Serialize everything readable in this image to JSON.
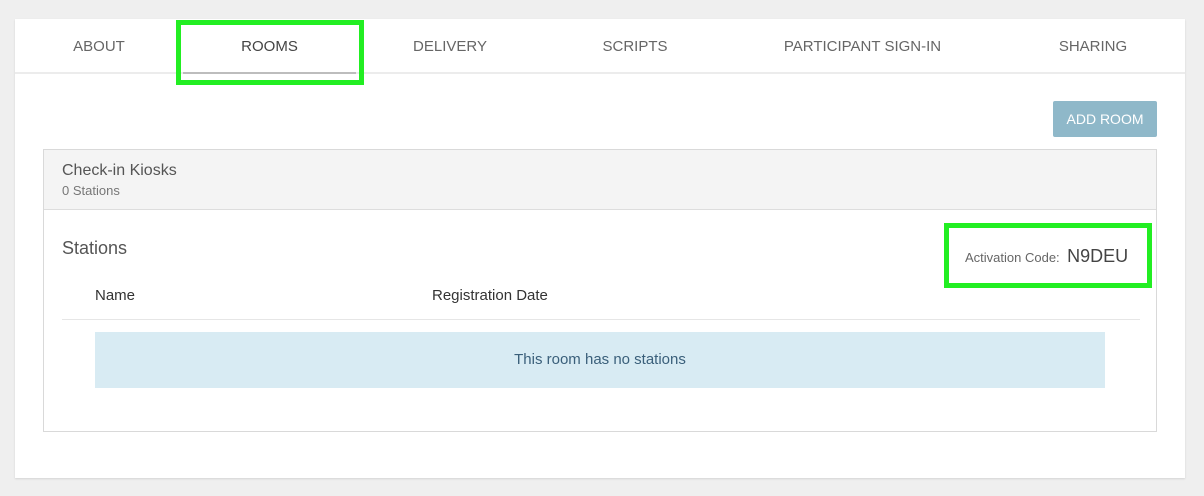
{
  "tabs": [
    {
      "label": "About"
    },
    {
      "label": "Rooms"
    },
    {
      "label": "Delivery"
    },
    {
      "label": "Scripts"
    },
    {
      "label": "Participant Sign-in"
    },
    {
      "label": "Sharing"
    }
  ],
  "active_tab": "Rooms",
  "actions": {
    "add_room_label": "Add Room"
  },
  "room": {
    "title": "Check-in Kiosks",
    "station_count": "0 Stations"
  },
  "stations": {
    "title": "Stations",
    "activation_label": "Activation Code:",
    "activation_code": "N9DEU",
    "columns": [
      "Name",
      "Registration Date"
    ],
    "empty_message": "This room has no stations"
  },
  "colors": {
    "highlight": "#22ee22",
    "button": "#8fb8c9",
    "empty_bg": "#d8ebf3"
  }
}
